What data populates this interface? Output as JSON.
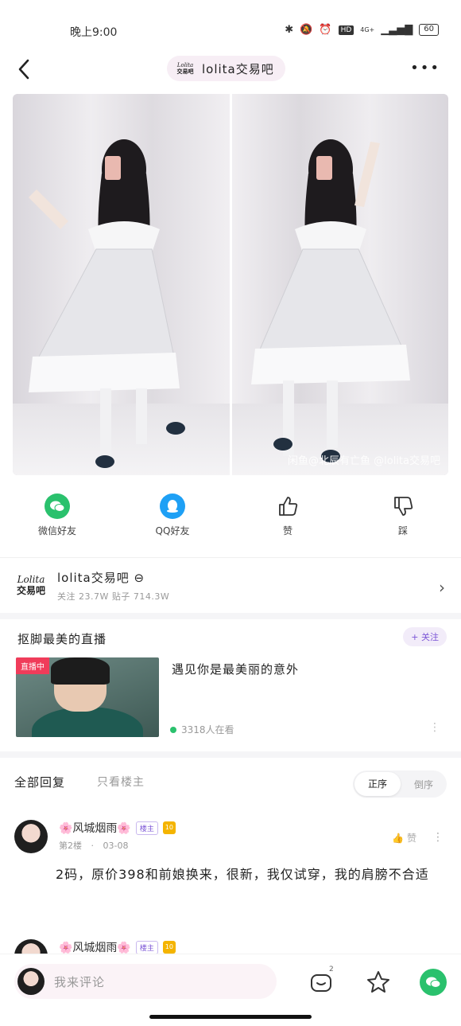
{
  "status_bar": {
    "time": "晚上9:00",
    "network": "4G+",
    "battery": "60"
  },
  "header": {
    "logo_top": "Lolita",
    "logo_bottom": "交易吧",
    "forum_name": "lolita交易吧",
    "more": "•••"
  },
  "post_image": {
    "watermark": "闲鱼@北辰有亡鱼 @lolita交易吧"
  },
  "share": [
    {
      "label": "微信好友",
      "icon": "wechat-icon",
      "color": "#2ac16d"
    },
    {
      "label": "QQ好友",
      "icon": "qq-icon",
      "color": "#1ea0f5"
    },
    {
      "label": "赞",
      "icon": "thumbs-up-icon"
    },
    {
      "label": "踩",
      "icon": "thumbs-down-icon"
    }
  ],
  "forum": {
    "logo_top": "Lolita",
    "logo_bottom": "交易吧",
    "name": "lolita交易吧",
    "stats": "关注 23.7W  贴子 714.3W"
  },
  "live": {
    "section_title": "抠脚最美的直播",
    "follow": "+ 关注",
    "badge": "直播中",
    "title": "遇见你是最美丽的意外",
    "viewers": "3318人在看"
  },
  "replies": {
    "tab_all": "全部回复",
    "tab_owner": "只看楼主",
    "order_asc": "正序",
    "order_desc": "倒序"
  },
  "posts": [
    {
      "name": "🌸风城烟雨🌸",
      "tag": "楼主",
      "level": "10",
      "floor": "第2楼",
      "date": "03-08",
      "like": "赞",
      "text": "2码，原价398和前娘换来，很新，我仅试穿，我的肩膀不合适"
    },
    {
      "name": "🌸风城烟雨🌸",
      "tag": "楼主",
      "level": "10"
    }
  ],
  "bottom_bar": {
    "placeholder": "我来评论",
    "comment_count": "2"
  },
  "colors": {
    "accent": "#7b55d6",
    "live_red": "#f03c5a",
    "wechat": "#2ac16d",
    "qq": "#1ea0f5"
  }
}
